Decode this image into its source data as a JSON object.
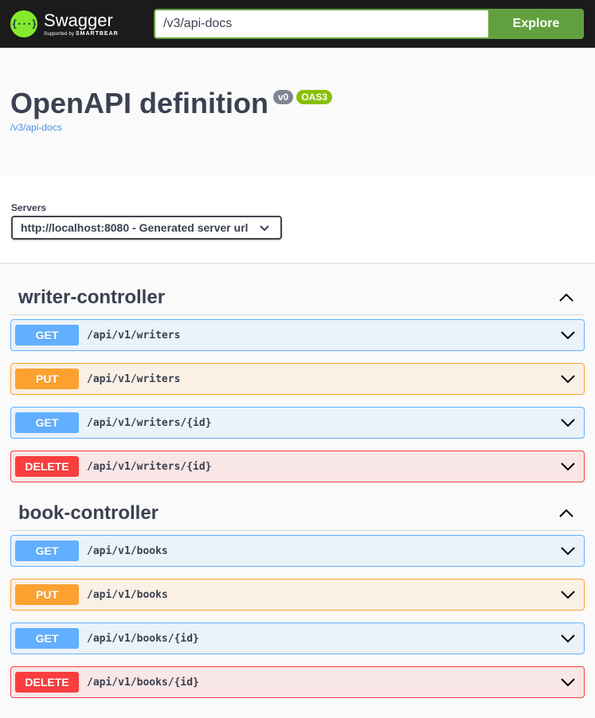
{
  "topbar": {
    "logo_name": "Swagger",
    "logo_sub_prefix": "Supported by",
    "logo_sub_brand": "SMARTBEAR",
    "logo_mark": "{···}",
    "search_value": "/v3/api-docs",
    "explore_label": "Explore"
  },
  "info": {
    "title": "OpenAPI definition",
    "version_badge": "v0",
    "oas_badge": "OAS3",
    "link": "/v3/api-docs"
  },
  "servers": {
    "label": "Servers",
    "selected": "http://localhost:8080 - Generated server url",
    "chevron_icon": "chevron-down-icon"
  },
  "tags": [
    {
      "name": "writer-controller",
      "expanded": true,
      "operations": [
        {
          "method": "GET",
          "path": "/api/v1/writers"
        },
        {
          "method": "PUT",
          "path": "/api/v1/writers"
        },
        {
          "method": "GET",
          "path": "/api/v1/writers/{id}"
        },
        {
          "method": "DELETE",
          "path": "/api/v1/writers/{id}"
        }
      ]
    },
    {
      "name": "book-controller",
      "expanded": true,
      "operations": [
        {
          "method": "GET",
          "path": "/api/v1/books"
        },
        {
          "method": "PUT",
          "path": "/api/v1/books"
        },
        {
          "method": "GET",
          "path": "/api/v1/books/{id}"
        },
        {
          "method": "DELETE",
          "path": "/api/v1/books/{id}"
        }
      ]
    }
  ],
  "colors": {
    "topbar_bg": "#1b1b1b",
    "explore_green": "#62a03f",
    "get": "#61affe",
    "put": "#fca130",
    "delete": "#f93e3e",
    "version_badge": "#7d8492",
    "oas_badge": "#89bf04"
  }
}
